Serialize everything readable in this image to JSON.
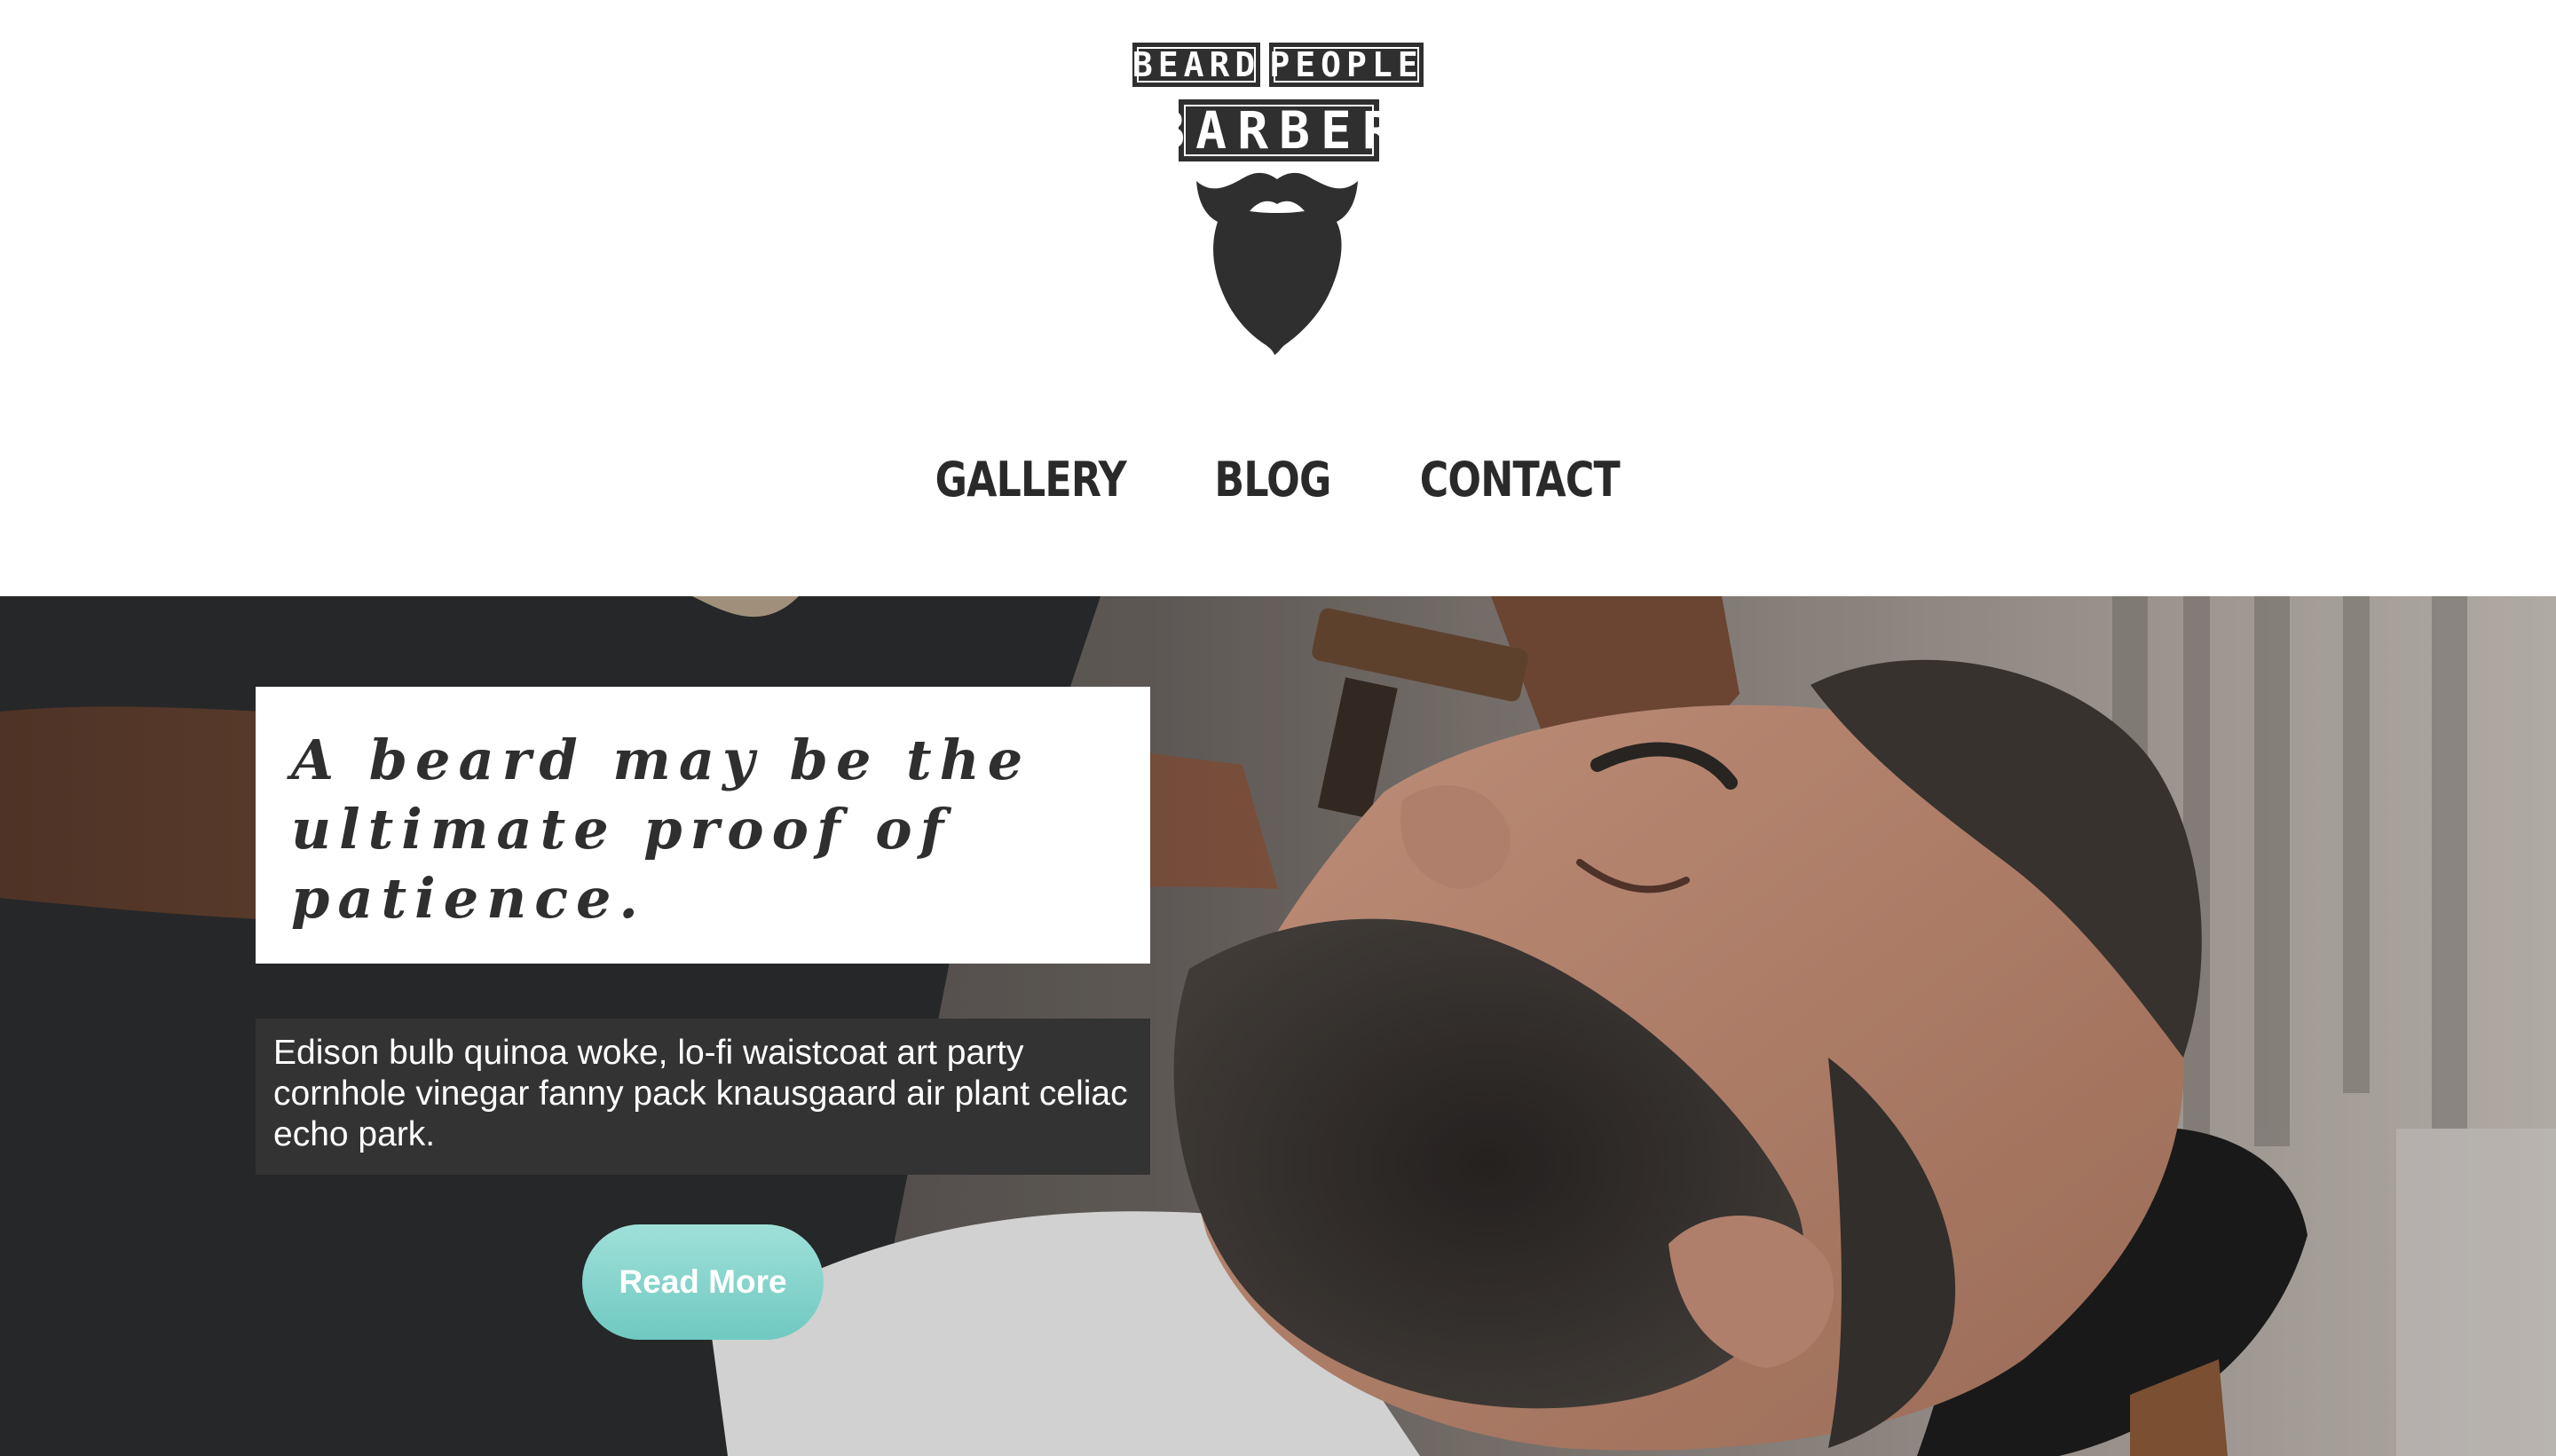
{
  "logo": {
    "line1_left": "BEARD",
    "line1_right": "PEOPLE",
    "line2": "BARBER"
  },
  "nav": {
    "items": [
      {
        "label": "GALLERY"
      },
      {
        "label": "BLOG"
      },
      {
        "label": "CONTACT"
      }
    ]
  },
  "hero": {
    "quote": "A beard may be the ultimate proof of patience.",
    "description": "Edison bulb quinoa woke, lo-fi waistcoat art party cornhole vinegar fanny pack knausgaard air plant celiac echo park.",
    "button_label": "Read More"
  },
  "colors": {
    "dark": "#2f2f2f",
    "button_teal": "#79cdc6",
    "desc_bg": "#333333"
  }
}
